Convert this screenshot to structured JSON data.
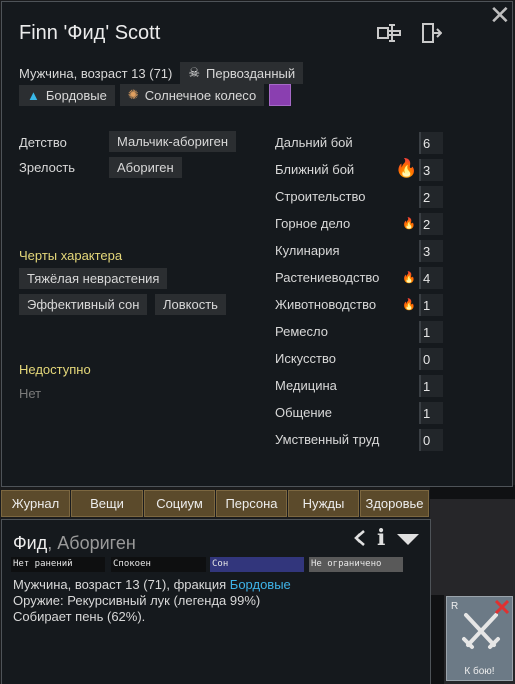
{
  "header": {
    "name": "Finn 'Фид' Scott",
    "description": "Мужчина, возраст 13 (71)",
    "xenotype": "Первозданный",
    "faction": "Бордовые",
    "ideology": "Солнечное колесо",
    "favorite_color": "#8a3fb0"
  },
  "backstory": {
    "childhood_label": "Детство",
    "childhood": "Мальчик-абориген",
    "adulthood_label": "Зрелость",
    "adulthood": "Абориген"
  },
  "traits": {
    "title": "Черты характера",
    "items": [
      "Тяжёлая неврастения",
      "Эффективный сон",
      "Ловкость"
    ]
  },
  "incapable": {
    "title": "Недоступно",
    "value": "Нет"
  },
  "skills": [
    {
      "name": "Дальний бой",
      "level": "6",
      "passion": 0
    },
    {
      "name": "Ближний бой",
      "level": "3",
      "passion": 2
    },
    {
      "name": "Строительство",
      "level": "2",
      "passion": 0
    },
    {
      "name": "Горное дело",
      "level": "2",
      "passion": 1
    },
    {
      "name": "Кулинария",
      "level": "3",
      "passion": 0
    },
    {
      "name": "Растениеводство",
      "level": "4",
      "passion": 1
    },
    {
      "name": "Животноводство",
      "level": "1",
      "passion": 1
    },
    {
      "name": "Ремесло",
      "level": "1",
      "passion": 0
    },
    {
      "name": "Искусство",
      "level": "0",
      "passion": 0
    },
    {
      "name": "Медицина",
      "level": "1",
      "passion": 0
    },
    {
      "name": "Общение",
      "level": "1",
      "passion": 0
    },
    {
      "name": "Умственный труд",
      "level": "0",
      "passion": 0
    }
  ],
  "tabs": [
    "Журнал",
    "Вещи",
    "Социум",
    "Персона",
    "Нужды",
    "Здоровье"
  ],
  "inspect": {
    "name": "Фид",
    "kind": ", Абориген",
    "health": "Нет ранений",
    "mood": "Спокоен",
    "rest": "Сон",
    "restriction": "Не ограничено",
    "line1_prefix": "Мужчина, возраст 13 (71), фракция ",
    "line1_faction": "Бордовые",
    "weapon": "Оружие: Рекурсивный лук (легенда 99%)",
    "job": "Собирает пень (62%)."
  },
  "fight_button": {
    "hotkey": "R",
    "label": "К бою!"
  }
}
